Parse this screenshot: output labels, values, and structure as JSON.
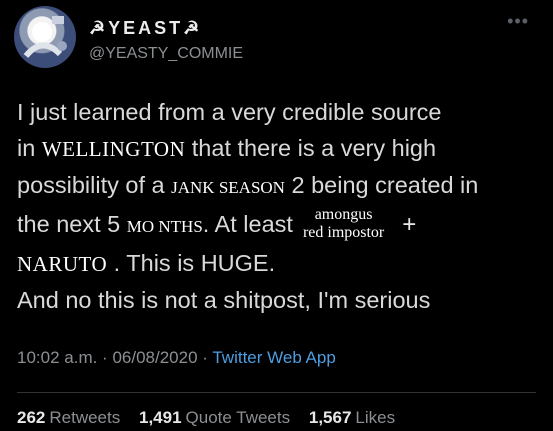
{
  "author": {
    "display_name": "☭YEAST☭",
    "handle": "@YEASTY_COMMIE"
  },
  "tweet": {
    "line1": "I just learned from a very credible source",
    "line2_pre": "in ",
    "line2_city": "WELLINGTON",
    "line2_post": " that there is a very high",
    "line3_pre": "possibility of a ",
    "line3_show": "JANK SEASON",
    "line3_post": " 2 being created in",
    "line4_pre": "the next 5 ",
    "line4_months": "MO NTHS",
    "line4_post": ". At least",
    "stack_top": "amongus",
    "stack_bottom": "red impostor",
    "plus": "+",
    "line5_word": "NARUTO",
    "line5_post": " . This is HUGE.",
    "line6": "And no this is not a shitpost, I'm serious"
  },
  "meta": {
    "time": "10:02 a.m.",
    "sep1": " · ",
    "date": "06/08/2020",
    "sep2": " · ",
    "app": "Twitter Web App"
  },
  "stats": {
    "retweets_count": "262",
    "retweets_label": "Retweets",
    "quotes_count": "1,491",
    "quotes_label": "Quote Tweets",
    "likes_count": "1,567",
    "likes_label": "Likes"
  },
  "icons": {
    "more": "more-icon",
    "avatar": "avatar"
  }
}
